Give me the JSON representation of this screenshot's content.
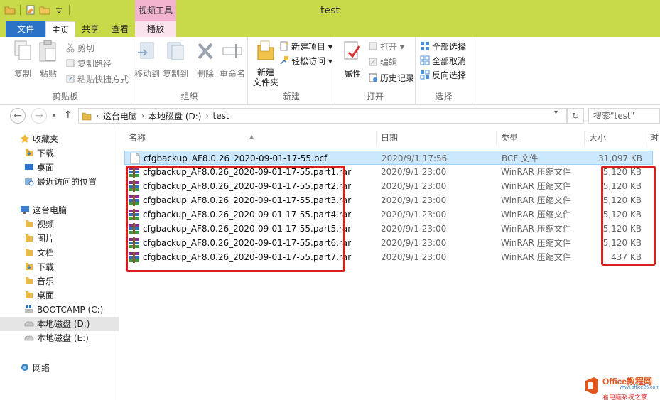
{
  "window": {
    "title": "test",
    "context_tab_group": "视频工具"
  },
  "ribbon_tabs": [
    {
      "label": "文件"
    },
    {
      "label": "主页"
    },
    {
      "label": "共享"
    },
    {
      "label": "查看"
    },
    {
      "label": "播放"
    }
  ],
  "ribbon": {
    "clipboard": {
      "label": "剪贴板",
      "copy": "复制",
      "paste": "粘贴",
      "cut": "剪切",
      "copy_path": "复制路径",
      "paste_shortcut": "粘贴快捷方式"
    },
    "organize": {
      "label": "组织",
      "move_to": "移动到",
      "copy_to": "复制到",
      "delete": "删除",
      "rename": "重命名"
    },
    "new": {
      "label": "新建",
      "new_folder": "新建\n文件夹",
      "new_item": "新建项目",
      "easy_access": "轻松访问"
    },
    "open": {
      "label": "打开",
      "properties": "属性",
      "open": "打开",
      "edit": "编辑",
      "history": "历史记录"
    },
    "select": {
      "label": "选择",
      "select_all": "全部选择",
      "select_none": "全部取消",
      "invert": "反向选择"
    }
  },
  "address": {
    "crumbs": [
      "这台电脑",
      "本地磁盘 (D:)",
      "test"
    ],
    "search_placeholder": "搜索\"test\""
  },
  "sidebar": {
    "favorites": "收藏夹",
    "fav_items": [
      "下载",
      "桌面",
      "最近访问的位置"
    ],
    "this_pc": "这台电脑",
    "pc_items": [
      "视频",
      "图片",
      "文档",
      "下载",
      "音乐",
      "桌面",
      "BOOTCAMP (C:)",
      "本地磁盘 (D:)",
      "本地磁盘 (E:)"
    ],
    "network": "网络"
  },
  "columns": {
    "name": "名称",
    "date": "日期",
    "type": "类型",
    "size": "大小",
    "extra": "时"
  },
  "files": [
    {
      "name": "cfgbackup_AF8.0.26_2020-09-01-17-55.bcf",
      "date": "2020/9/1 17:56",
      "type": "BCF 文件",
      "size": "31,097 KB",
      "icon": "file-icon"
    },
    {
      "name": "cfgbackup_AF8.0.26_2020-09-01-17-55.part1.rar",
      "date": "2020/9/1 23:00",
      "type": "WinRAR 压缩文件",
      "size": "5,120 KB",
      "icon": "winrar-icon"
    },
    {
      "name": "cfgbackup_AF8.0.26_2020-09-01-17-55.part2.rar",
      "date": "2020/9/1 23:00",
      "type": "WinRAR 压缩文件",
      "size": "5,120 KB",
      "icon": "winrar-icon"
    },
    {
      "name": "cfgbackup_AF8.0.26_2020-09-01-17-55.part3.rar",
      "date": "2020/9/1 23:00",
      "type": "WinRAR 压缩文件",
      "size": "5,120 KB",
      "icon": "winrar-icon"
    },
    {
      "name": "cfgbackup_AF8.0.26_2020-09-01-17-55.part4.rar",
      "date": "2020/9/1 23:00",
      "type": "WinRAR 压缩文件",
      "size": "5,120 KB",
      "icon": "winrar-icon"
    },
    {
      "name": "cfgbackup_AF8.0.26_2020-09-01-17-55.part5.rar",
      "date": "2020/9/1 23:00",
      "type": "WinRAR 压缩文件",
      "size": "5,120 KB",
      "icon": "winrar-icon"
    },
    {
      "name": "cfgbackup_AF8.0.26_2020-09-01-17-55.part6.rar",
      "date": "2020/9/1 23:00",
      "type": "WinRAR 压缩文件",
      "size": "5,120 KB",
      "icon": "winrar-icon"
    },
    {
      "name": "cfgbackup_AF8.0.26_2020-09-01-17-55.part7.rar",
      "date": "2020/9/1 23:00",
      "type": "WinRAR 压缩文件",
      "size": "437 KB",
      "icon": "winrar-icon"
    }
  ],
  "watermark": {
    "line1": "Office教程网",
    "line2": "www.office26.com",
    "line3": "看电脑系统之家"
  },
  "colors": {
    "titlebar": "#c8d94a",
    "file_tab": "#2b73c7",
    "context_tab": "#f3b4d0",
    "selection": "#cce8ff",
    "highlight_box": "#d91e1e"
  }
}
